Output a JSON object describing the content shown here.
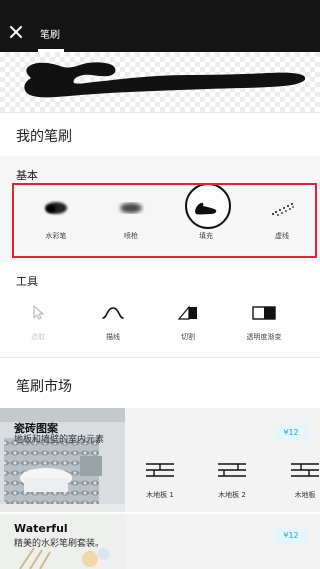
{
  "header": {
    "tab_label": "笔刷",
    "close_icon": "close-icon"
  },
  "my_brushes": {
    "title": "我的笔刷"
  },
  "basic": {
    "title": "基本",
    "brushes": [
      {
        "label": "水彩笔",
        "icon": "watercolor-brush-icon"
      },
      {
        "label": "喷枪",
        "icon": "airbrush-icon"
      },
      {
        "label": "填充",
        "icon": "fill-brush-icon",
        "selected": true
      },
      {
        "label": "虚线",
        "icon": "dashed-line-brush-icon"
      }
    ]
  },
  "tools": {
    "title": "工具",
    "items": [
      {
        "label": "选取",
        "icon": "cursor-icon",
        "enabled": false
      },
      {
        "label": "描线",
        "icon": "curve-icon",
        "enabled": true
      },
      {
        "label": "切割",
        "icon": "cut-icon",
        "enabled": true
      },
      {
        "label": "透明度渐变",
        "icon": "opacity-gradient-icon",
        "enabled": true
      }
    ]
  },
  "market": {
    "title": "笔刷市场",
    "cards": [
      {
        "title": "瓷砖图案",
        "description": "地板和墙壁的室内元素",
        "price": "¥12",
        "items": [
          {
            "label": "木地板 1",
            "icon": "wood-floor-1-icon"
          },
          {
            "label": "木地板 2",
            "icon": "wood-floor-2-icon"
          },
          {
            "label": "木地板",
            "icon": "wood-floor-3-icon"
          }
        ]
      },
      {
        "title": "Waterful",
        "description": "精美的水彩笔刷套装。",
        "price": "¥12"
      }
    ]
  },
  "colors": {
    "highlight": "#e1233a",
    "price_text": "#2aa7d8",
    "price_bg": "#e4f5fb",
    "topbar": "#141414"
  }
}
